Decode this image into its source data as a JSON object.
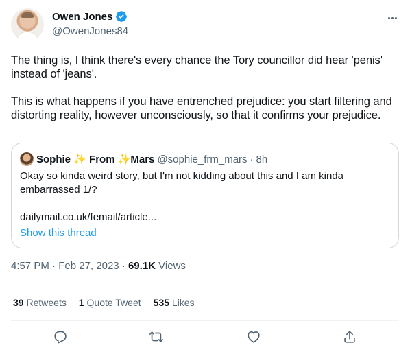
{
  "author": {
    "display_name": "Owen Jones",
    "handle": "@OwenJones84",
    "verified": true
  },
  "tweet_text": "The thing is, I think there's every chance the Tory councillor did hear 'penis' instead of 'jeans'.\n\nThis is what happens if you have entrenched prejudice: you start filtering and distorting reality, however unconsciously, so that it confirms your prejudice.",
  "quote": {
    "name_part1": "Sophie",
    "name_part2": "From",
    "name_part3": "Mars",
    "sparkle": "✨",
    "handle": "@sophie_frm_mars",
    "separator": "·",
    "time": "8h",
    "text": "Okay so kinda weird story, but I'm not kidding about this and I am kinda embarrassed 1/?\n\ndailymail.co.uk/femail/article...",
    "show_thread": "Show this thread"
  },
  "meta": {
    "time": "4:57 PM",
    "dot1": "·",
    "date": "Feb 27, 2023",
    "dot2": "·",
    "views_count": "69.1K",
    "views_label": "Views"
  },
  "stats": {
    "retweets_count": "39",
    "retweets_label": "Retweets",
    "quotes_count": "1",
    "quotes_label": "Quote Tweet",
    "likes_count": "535",
    "likes_label": "Likes"
  },
  "icons": {
    "verified": "verified-badge-icon",
    "more": "more-icon",
    "reply": "reply-icon",
    "retweet": "retweet-icon",
    "like": "like-icon",
    "share": "share-icon"
  },
  "colors": {
    "text": "#0f1419",
    "secondary": "#536471",
    "link": "#1d9bf0",
    "border": "#cfd9de",
    "verified": "#1d9bf0"
  }
}
